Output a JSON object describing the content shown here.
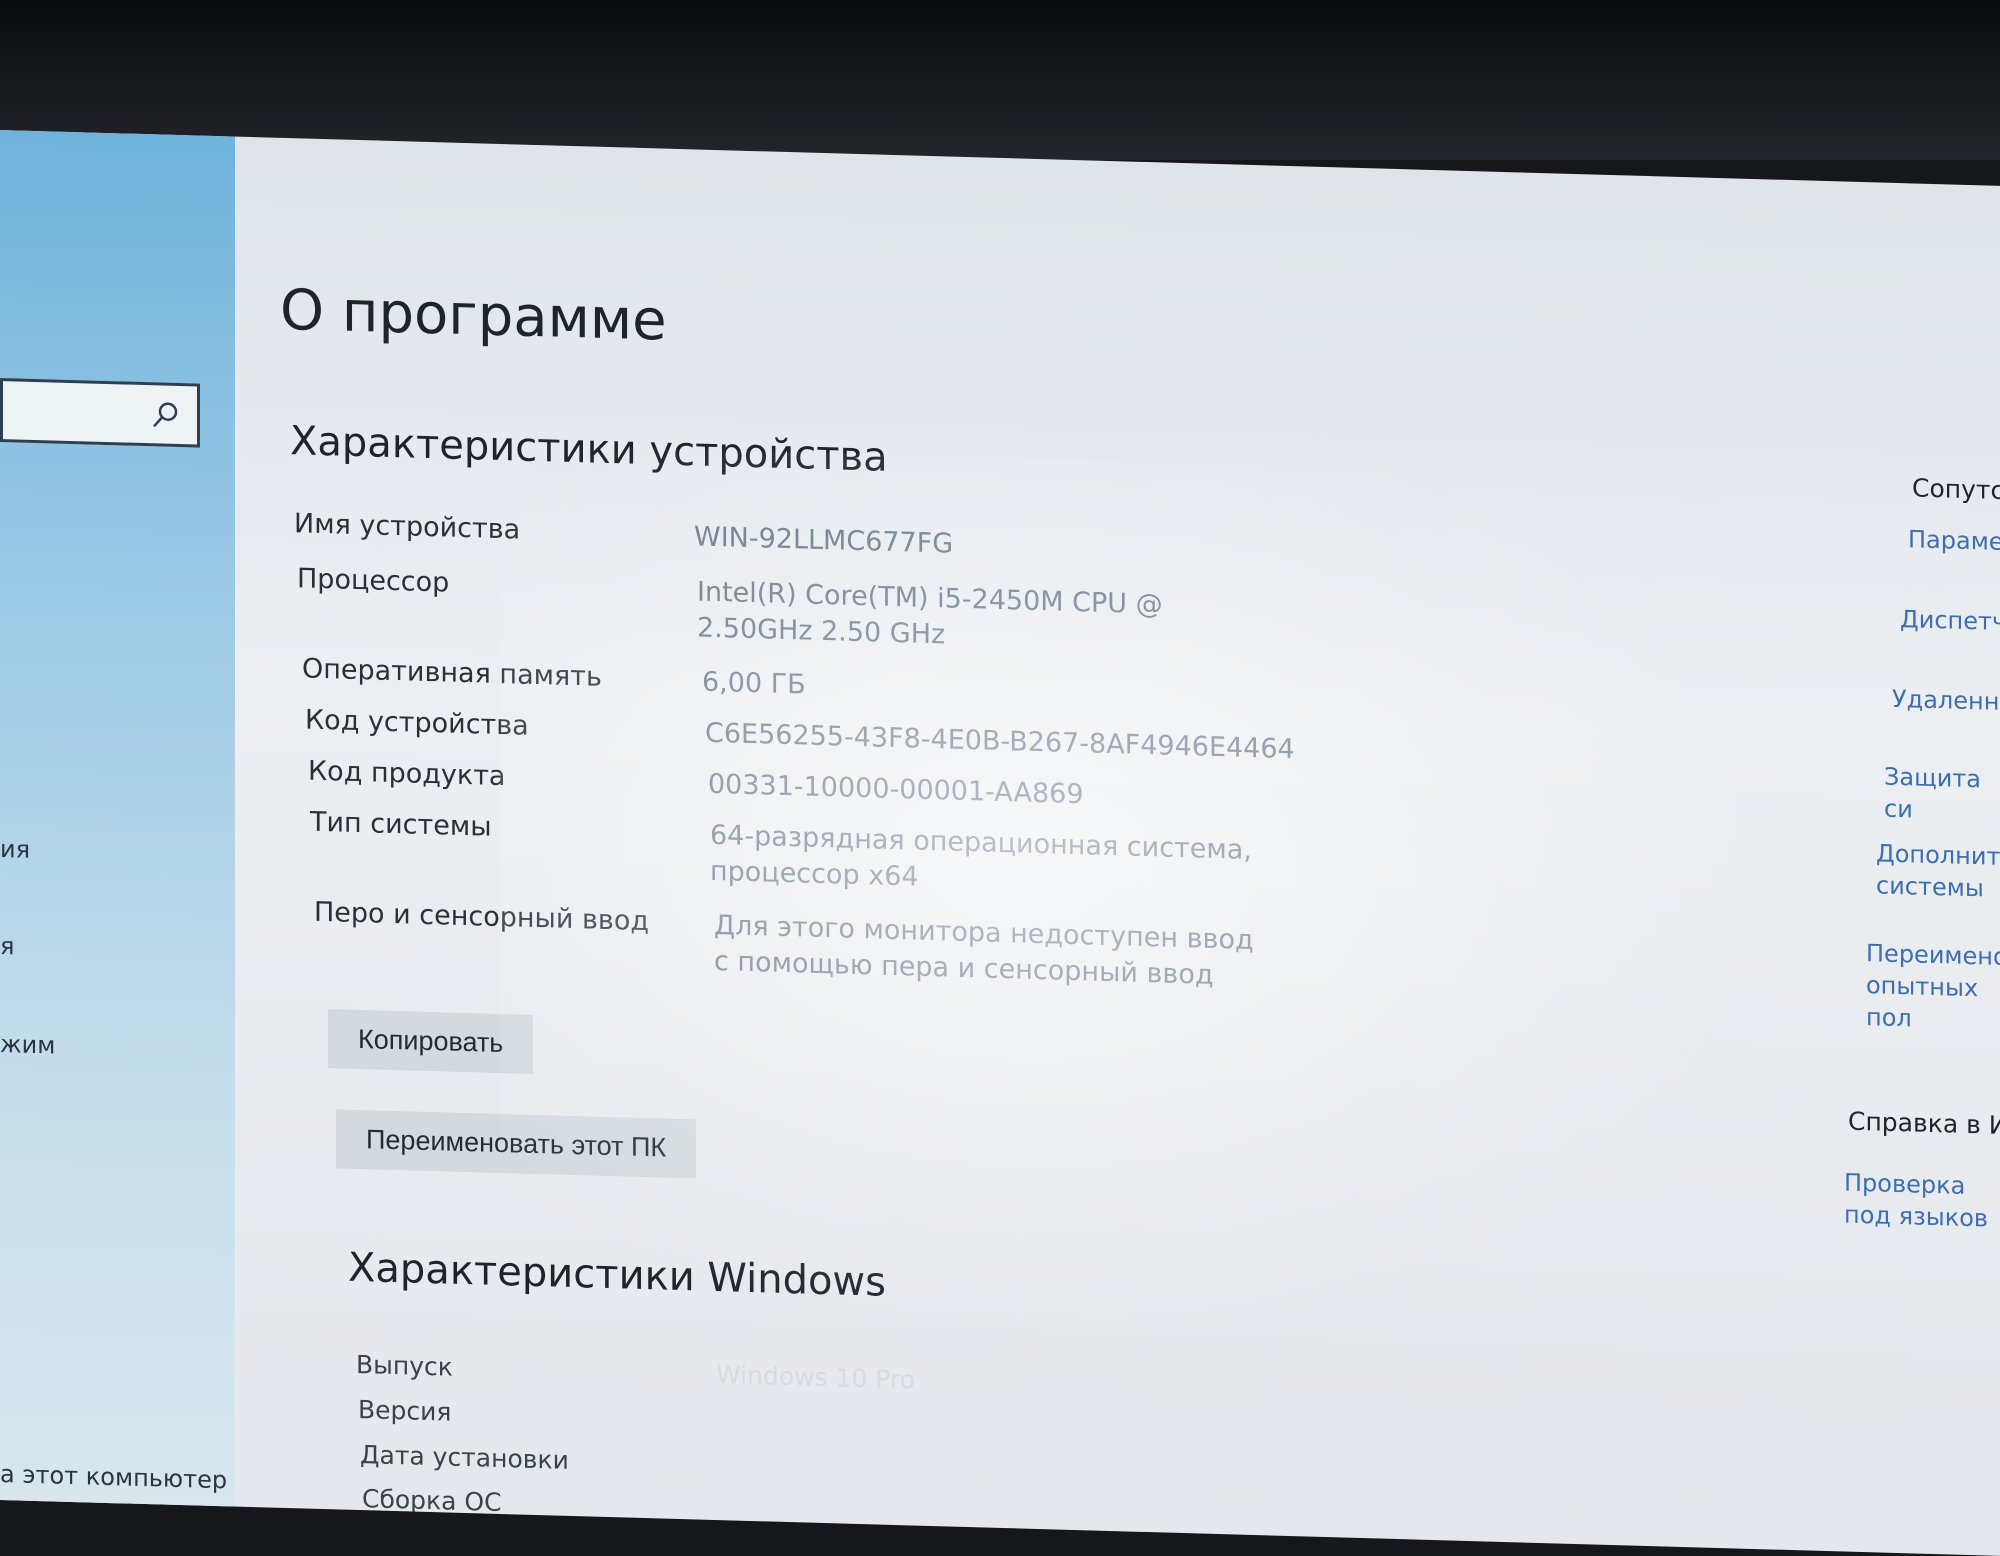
{
  "sidebar": {
    "search_placeholder": "",
    "items": [
      {
        "label": "ия"
      },
      {
        "label": "я"
      },
      {
        "label": "жим"
      },
      {
        "label": "а этот компьютер"
      }
    ]
  },
  "page": {
    "title": "О программе"
  },
  "device": {
    "heading": "Характеристики устройства",
    "rows": [
      {
        "label": "Имя устройства",
        "value": "WIN-92LLMC677FG"
      },
      {
        "label": "Процессор",
        "value": "Intel(R) Core(TM) i5-2450M CPU @ 2.50GHz   2.50 GHz"
      },
      {
        "label": "Оперативная память",
        "value": "6,00 ГБ"
      },
      {
        "label": "Код устройства",
        "value": "C6E56255-43F8-4E0B-B267-8AF4946E4464"
      },
      {
        "label": "Код продукта",
        "value": "00331-10000-00001-AA869"
      },
      {
        "label": "Тип системы",
        "value": "64-разрядная операционная система, процессор x64"
      },
      {
        "label": "Перо и сенсорный ввод",
        "value": "Для этого монитора недоступен ввод с помощью пера и сенсорный ввод"
      }
    ],
    "copy_button": "Копировать",
    "rename_button": "Переименовать этот ПК"
  },
  "windows": {
    "heading": "Характеристики Windows",
    "rows": [
      {
        "label": "Выпуск",
        "value": "Windows 10 Pro"
      },
      {
        "label": "Версия",
        "value": ""
      },
      {
        "label": "Дата установки",
        "value": ""
      },
      {
        "label": "Сборка ОС",
        "value": ""
      }
    ]
  },
  "related": {
    "heading": "Сопутс",
    "links": [
      {
        "label": "Параме"
      },
      {
        "label": "Диспетч"
      },
      {
        "label": "Удаленны"
      },
      {
        "label": "Защита си"
      },
      {
        "label": "Дополните системы"
      },
      {
        "label": "Переименов опытных пол"
      }
    ],
    "help_heading": "Справка в Ин",
    "help_links": [
      {
        "label": "Проверка под языков"
      }
    ]
  }
}
